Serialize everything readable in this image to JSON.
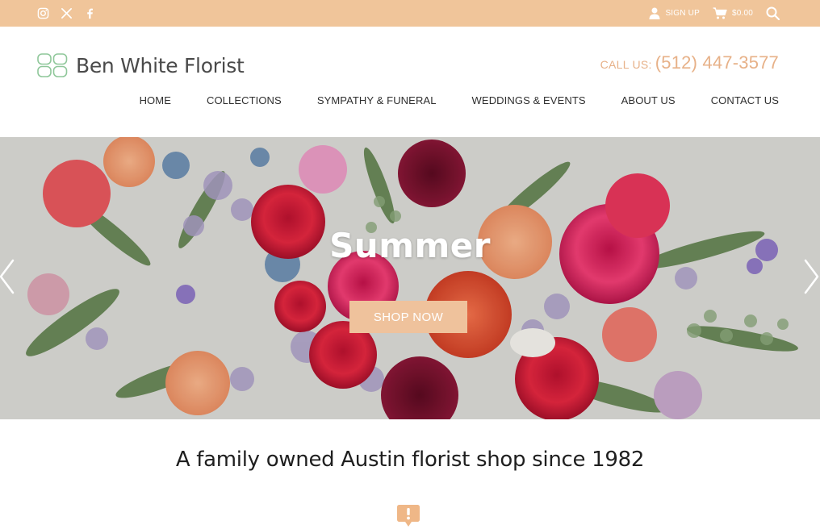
{
  "topbar": {
    "social": [
      "instagram-icon",
      "x-icon",
      "facebook-icon"
    ],
    "signup_label": "SIGN UP",
    "cart_total": "$0.00",
    "bg_color": "#f0c59a"
  },
  "header": {
    "logo_text": "Ben White Florist",
    "call_label": "CALL US:",
    "phone": "(512) 447-3577",
    "accent_color": "#e7b188"
  },
  "nav": {
    "items": [
      "HOME",
      "COLLECTIONS",
      "SYMPATHY & FUNERAL",
      "WEDDINGS & EVENTS",
      "ABOUT US",
      "CONTACT US"
    ]
  },
  "hero": {
    "title": "Summer",
    "button_label": "SHOP NOW"
  },
  "tagline": "A family owned Austin florist shop since 1982"
}
